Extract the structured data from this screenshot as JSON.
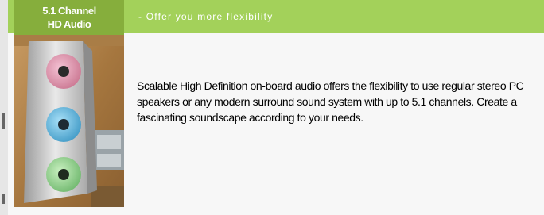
{
  "feature": {
    "badge_line1": "5.1 Channel",
    "badge_line2": "HD Audio",
    "tagline": "- Offer you more flexibility",
    "description": "Scalable High Definition on-board audio offers the flexibility to use regular stereo PC speakers or any modern surround sound system with up to 5.1 channels. Create a fascinating soundscape according to your needs."
  },
  "colors": {
    "header_bg": "#a3d15a",
    "badge_bg": "#86ae3c",
    "panel_bg": "#f7f7f7"
  }
}
